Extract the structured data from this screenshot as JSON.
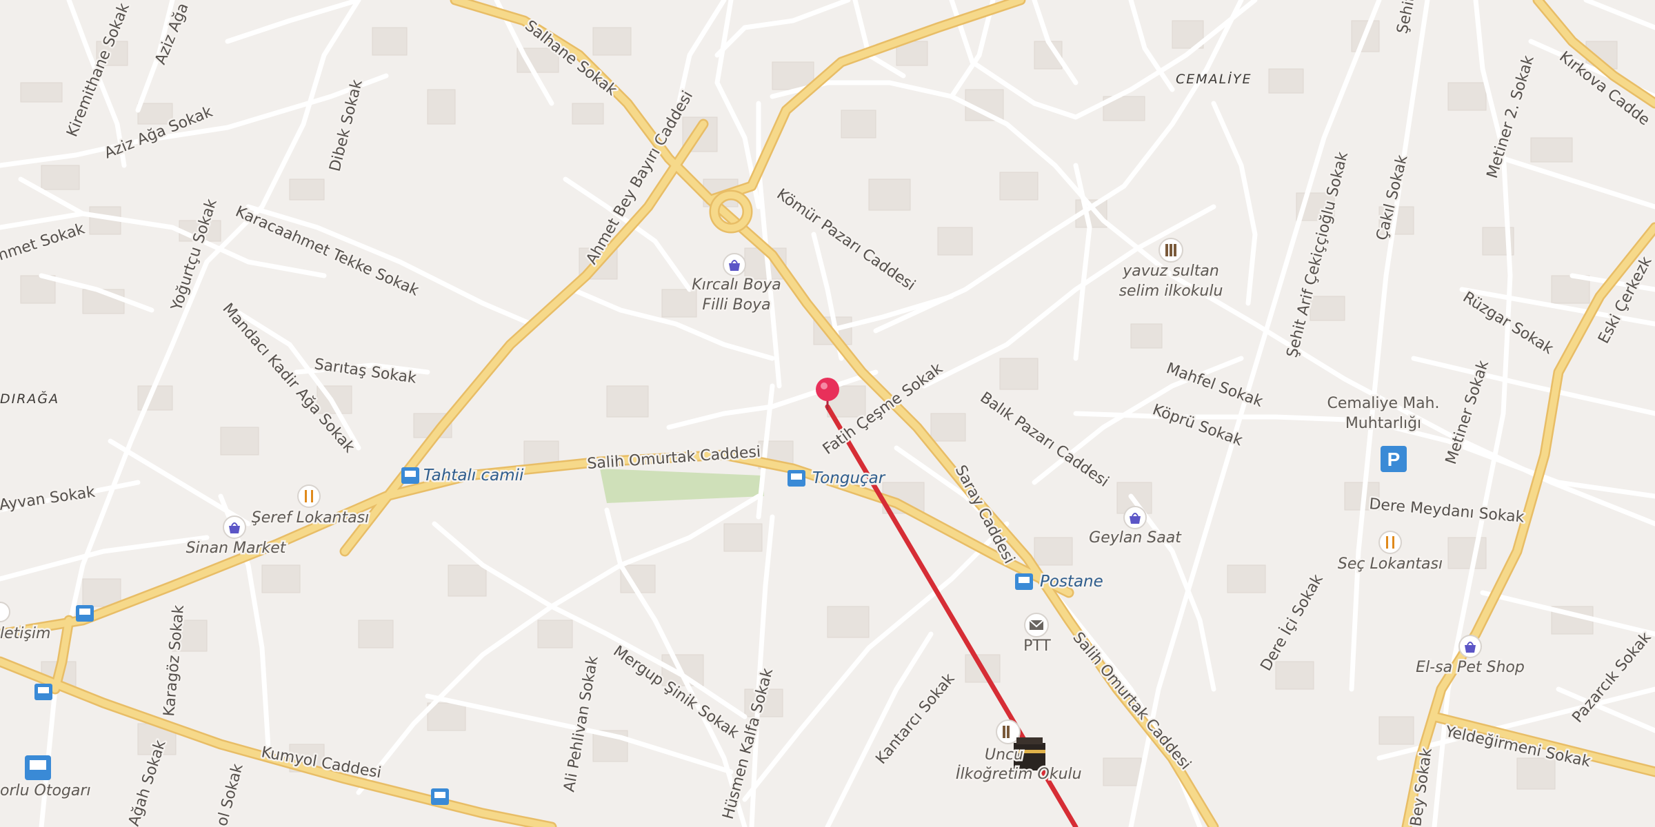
{
  "districts": {
    "cemaliye": "CEMALİYE",
    "diraga": "DIRAĞA"
  },
  "streets": {
    "salhane": "Salhane Sokak",
    "kirkova": "Kırkova Cadde",
    "kiremithane": "Kiremithane Sokak",
    "aziz_aga_top": "Aziz Ağa",
    "aziz_aga": "Aziz Ağa Sokak",
    "dibek": "Dibek Sokak",
    "ahmet_bey": "Ahmet Bey Bayırı Caddesi",
    "komur": "Kömür Pazarı Caddesi",
    "sehit": "Şehit",
    "sehit_arif": "Şehit Arif Çekiççioğlu Sokak",
    "cakil": "Çakıl Sokak",
    "metiner2": "Metiner 2. Sokak",
    "eski_cerkez": "Eski Çerkezk",
    "ahmet_sokak": "hmet Sokak",
    "karacaahmet": "Karacaahmet Tekke Sokak",
    "yogurtcu": "Yoğurtçu Sokak",
    "mandaci": "Mandacı Kadir Ağa Sokak",
    "saritas": "Sarıtaş Sokak",
    "fatih_cesme": "Fatih Çeşme Sokak",
    "balik": "Balık Pazarı Caddesi",
    "mahfel": "Mahfel Sokak",
    "kopru": "Köprü Sokak",
    "ruzgar": "Rüzgar Sokak",
    "metiner": "Metiner Sokak",
    "salih_omurtak": "Salih Omurtak Caddesi",
    "salih_omurtak_2": "Salih Omurtak Caddesi",
    "saray": "Saray Caddesi",
    "dere_meydani": "Dere Meydanı Sokak",
    "dere_ici": "Dere İçi Sokak",
    "ayvan": "Ayvan Sokak",
    "karagoz": "Karagöz Sokak",
    "mergup": "Mergup Şinik Sokak",
    "ali_pehlivan": "Ali Pehlivan Sokak",
    "husmen": "Hüsmen Kalfa Sokak",
    "kantarci": "Kantarcı Sokak",
    "pazarcik": "Pazarcık Sokak",
    "yeldegirmeni": "Yeldeğirmeni Sokak",
    "kumyol": "Kumyol Caddesi",
    "agah": "Ağah Sokak",
    "sol_sokak": "ol Sokak",
    "bey": "Bey Sokak"
  },
  "pois": {
    "kircali": [
      "Kırcalı Boya",
      "Filli Boya"
    ],
    "yavuz": [
      "yavuz sultan",
      "selim ilkokulu"
    ],
    "cemaliye_muhtarlik": [
      "Cemaliye Mah.",
      "Muhtarlığı"
    ],
    "geylan": "Geylan Saat",
    "ptt": "PTT",
    "sec": "Seç Lokantası",
    "elsa": "El-sa Pet Shop",
    "seref": "Şeref Lokantası",
    "sinan": "Sinan Market",
    "iletisim": "letişim",
    "otogar": "orlu Otogarı",
    "uncu": [
      "Uncu",
      "İlkoğretim Okulu"
    ]
  },
  "bus_stops": {
    "tahtali": "Tahtalı camii",
    "tongucar": "Tonguçar",
    "postane": "Postane"
  },
  "icons": {
    "parking": "P",
    "route_color": "#d62d35",
    "pin_color": "#e8305a",
    "bus_color": "#3a8ad6",
    "road_major": "#f6d98a",
    "road_major_casing": "#e8bd66"
  }
}
